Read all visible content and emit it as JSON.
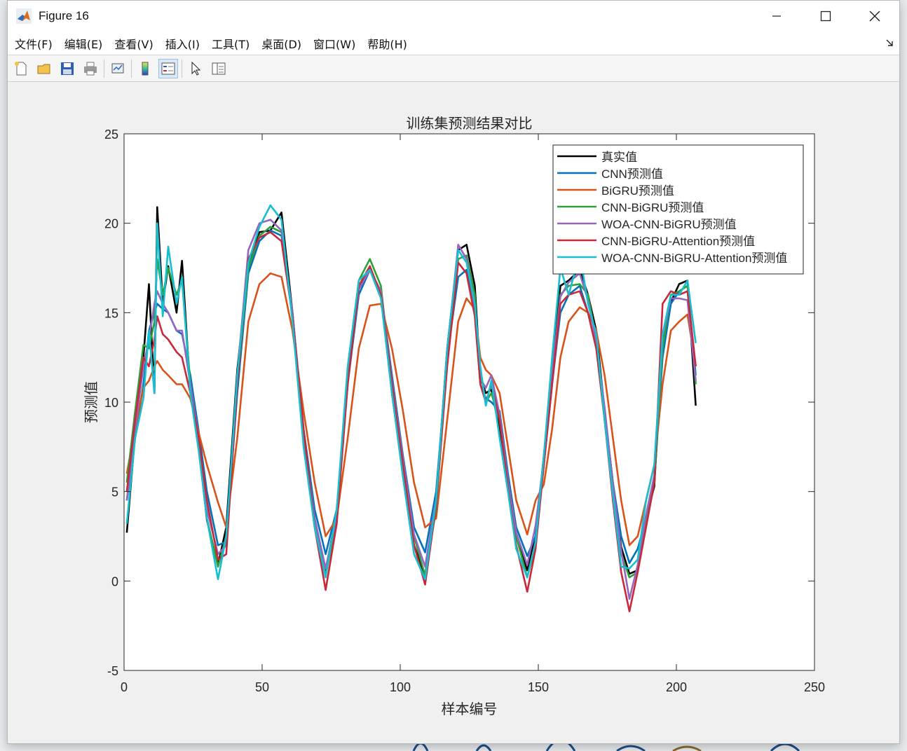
{
  "window": {
    "title": "Figure 16"
  },
  "menu": [
    "文件(F)",
    "编辑(E)",
    "查看(V)",
    "插入(I)",
    "工具(T)",
    "桌面(D)",
    "窗口(W)",
    "帮助(H)"
  ],
  "toolbar": {
    "icons": [
      "new-figure-icon",
      "open-file-icon",
      "save-icon",
      "print-icon",
      "link-plot-icon",
      "insert-colorbar-icon",
      "insert-legend-icon",
      "edit-plot-icon",
      "property-inspector-icon"
    ]
  },
  "colors": {
    "true": "#000000",
    "cnn": "#0072BD",
    "bigru": "#D95319",
    "cnn_bigru": "#2E9F3A",
    "woa_cnn_bigru": "#9467BD",
    "cnn_bigru_att": "#C8283A",
    "woa_cnn_bigru_att": "#17BECF"
  },
  "chart_data": {
    "type": "line",
    "title": "训练集预测结果对比",
    "xlabel": "样本编号",
    "ylabel": "预测值",
    "xlim": [
      0,
      250
    ],
    "ylim": [
      -5,
      25
    ],
    "xticks": [
      "0",
      "50",
      "100",
      "150",
      "200",
      "250"
    ],
    "yticks": [
      "-5",
      "0",
      "5",
      "10",
      "15",
      "20",
      "25"
    ],
    "grid": false,
    "legend_position": "top-right",
    "series": [
      {
        "name": "真实值",
        "color": "#000000",
        "x": [
          1,
          4,
          7,
          9,
          11,
          12,
          14,
          16,
          19,
          21,
          24,
          27,
          30,
          34,
          37,
          41,
          45,
          49,
          53,
          57,
          61,
          65,
          69,
          73,
          77,
          81,
          85,
          89,
          93,
          97,
          101,
          105,
          109,
          113,
          117,
          121,
          124,
          127,
          129,
          131,
          133,
          136,
          139,
          142,
          146,
          149,
          152,
          155,
          158,
          161,
          165,
          168,
          171,
          174,
          177,
          180,
          183,
          186,
          189,
          192,
          195,
          198,
          201,
          204,
          207
        ],
        "y": [
          2.7,
          8.2,
          12.5,
          16.6,
          10.5,
          20.9,
          15.5,
          17.6,
          15.0,
          17.9,
          10.5,
          7.6,
          3.4,
          0.9,
          3.0,
          11.8,
          17.5,
          19.5,
          19.6,
          20.6,
          15.0,
          8.0,
          3.5,
          0.6,
          3.8,
          11.6,
          16.5,
          17.5,
          16.0,
          10.5,
          6.0,
          2.0,
          0.3,
          4.5,
          13.0,
          18.5,
          18.8,
          16.5,
          11.4,
          10.5,
          10.7,
          8.5,
          5.5,
          2.5,
          0.6,
          2.5,
          7.0,
          11.8,
          16.5,
          16.8,
          17.4,
          16.0,
          14.0,
          9.5,
          5.5,
          1.9,
          0.4,
          0.6,
          3.5,
          5.3,
          13.5,
          15.6,
          16.6,
          16.8,
          9.8
        ]
      },
      {
        "name": "CNN预测值",
        "color": "#0072BD",
        "x": [
          1,
          4,
          7,
          9,
          11,
          12,
          14,
          16,
          19,
          21,
          24,
          27,
          30,
          34,
          37,
          41,
          45,
          49,
          53,
          57,
          61,
          65,
          69,
          73,
          77,
          81,
          85,
          89,
          93,
          97,
          101,
          105,
          109,
          113,
          117,
          121,
          124,
          127,
          129,
          131,
          133,
          136,
          139,
          142,
          146,
          149,
          152,
          155,
          158,
          161,
          165,
          168,
          171,
          174,
          177,
          180,
          183,
          186,
          189,
          192,
          195,
          198,
          201,
          204,
          207
        ],
        "y": [
          4.5,
          8.0,
          11.0,
          14.0,
          15.0,
          15.5,
          15.2,
          15.0,
          14.0,
          13.8,
          11.5,
          8.4,
          5.0,
          2.0,
          2.2,
          10.5,
          17.2,
          19.0,
          19.6,
          19.3,
          15.0,
          8.5,
          4.0,
          1.5,
          4.0,
          11.0,
          16.0,
          17.4,
          16.2,
          11.5,
          7.0,
          3.0,
          1.6,
          5.0,
          12.5,
          17.0,
          17.4,
          15.0,
          11.0,
          10.2,
          10.0,
          9.5,
          6.0,
          3.0,
          1.4,
          2.5,
          6.5,
          11.0,
          15.0,
          16.0,
          16.5,
          15.0,
          13.0,
          9.5,
          5.5,
          2.5,
          1.0,
          1.8,
          3.5,
          5.5,
          12.5,
          15.5,
          16.2,
          16.5,
          11.5
        ]
      },
      {
        "name": "BiGRU预测值",
        "color": "#D95319",
        "x": [
          1,
          4,
          7,
          9,
          11,
          12,
          14,
          16,
          19,
          21,
          24,
          27,
          30,
          34,
          37,
          41,
          45,
          49,
          53,
          57,
          61,
          65,
          69,
          73,
          77,
          81,
          85,
          89,
          93,
          97,
          101,
          105,
          109,
          113,
          117,
          121,
          124,
          127,
          129,
          131,
          133,
          136,
          139,
          142,
          146,
          149,
          152,
          155,
          158,
          161,
          165,
          168,
          171,
          174,
          177,
          180,
          183,
          186,
          189,
          192,
          195,
          198,
          201,
          204,
          207
        ],
        "y": [
          6.0,
          8.5,
          10.8,
          11.2,
          12.0,
          12.3,
          11.8,
          11.5,
          11.0,
          11.0,
          10.2,
          8.3,
          6.5,
          4.4,
          3.0,
          8.0,
          14.5,
          16.6,
          17.2,
          17.0,
          14.0,
          9.5,
          5.5,
          2.5,
          3.5,
          8.0,
          13.0,
          15.4,
          15.5,
          13.0,
          9.5,
          5.5,
          3.0,
          3.5,
          9.0,
          14.5,
          15.8,
          15.2,
          12.5,
          11.8,
          11.5,
          10.5,
          7.5,
          4.5,
          2.6,
          4.5,
          5.4,
          8.5,
          12.5,
          14.5,
          15.3,
          15.0,
          14.0,
          11.5,
          8.0,
          4.5,
          2.0,
          2.5,
          4.5,
          6.5,
          11.0,
          14.0,
          14.5,
          14.9,
          12.0
        ]
      },
      {
        "name": "CNN-BiGRU预测值",
        "color": "#2E9F3A",
        "x": [
          1,
          4,
          7,
          9,
          11,
          12,
          14,
          16,
          19,
          21,
          24,
          27,
          30,
          34,
          37,
          41,
          45,
          49,
          53,
          57,
          61,
          65,
          69,
          73,
          77,
          81,
          85,
          89,
          93,
          97,
          101,
          105,
          109,
          113,
          117,
          121,
          124,
          127,
          129,
          131,
          133,
          136,
          139,
          142,
          146,
          149,
          152,
          155,
          158,
          161,
          165,
          168,
          171,
          174,
          177,
          180,
          183,
          186,
          189,
          192,
          195,
          198,
          201,
          204,
          207
        ],
        "y": [
          5.5,
          9.5,
          13.2,
          13.0,
          14.5,
          18.0,
          16.0,
          17.5,
          16.0,
          16.8,
          11.0,
          7.5,
          3.5,
          0.8,
          2.5,
          11.0,
          17.5,
          19.3,
          19.8,
          19.5,
          14.8,
          8.0,
          3.5,
          0.3,
          3.5,
          11.5,
          16.8,
          18.0,
          16.5,
          11.0,
          6.5,
          2.5,
          0.3,
          4.0,
          12.5,
          18.0,
          18.2,
          16.0,
          11.0,
          10.0,
          10.5,
          9.0,
          5.5,
          2.5,
          0.2,
          2.0,
          6.5,
          11.5,
          16.0,
          16.5,
          16.6,
          16.0,
          13.5,
          9.0,
          5.0,
          1.5,
          0.2,
          0.5,
          3.5,
          5.5,
          13.0,
          16.0,
          16.2,
          16.5,
          11.0
        ]
      },
      {
        "name": "WOA-CNN-BiGRU预测值",
        "color": "#9467BD",
        "x": [
          1,
          4,
          7,
          9,
          11,
          12,
          14,
          16,
          19,
          21,
          24,
          27,
          30,
          34,
          37,
          41,
          45,
          49,
          53,
          57,
          61,
          65,
          69,
          73,
          77,
          81,
          85,
          89,
          93,
          97,
          101,
          105,
          109,
          113,
          117,
          121,
          124,
          127,
          129,
          131,
          133,
          136,
          139,
          142,
          146,
          149,
          152,
          155,
          158,
          161,
          165,
          168,
          171,
          174,
          177,
          180,
          183,
          186,
          189,
          192,
          195,
          198,
          201,
          204,
          207
        ],
        "y": [
          4.5,
          8.5,
          12.0,
          13.5,
          15.5,
          16.2,
          15.5,
          15.0,
          14.0,
          14.0,
          11.0,
          8.0,
          4.0,
          1.5,
          2.0,
          11.5,
          18.5,
          20.0,
          20.2,
          19.6,
          15.0,
          8.2,
          3.5,
          0.7,
          3.6,
          11.3,
          16.3,
          17.4,
          16.2,
          11.2,
          6.8,
          2.6,
          0.8,
          4.6,
          12.8,
          18.8,
          18.0,
          15.3,
          11.3,
          10.8,
          11.5,
          9.3,
          5.6,
          2.7,
          0.9,
          3.1,
          6.8,
          11.6,
          15.9,
          16.7,
          17.2,
          15.7,
          13.4,
          9.7,
          5.4,
          1.7,
          -1.0,
          0.9,
          3.7,
          5.9,
          13.7,
          15.8,
          15.8,
          15.7,
          11.2
        ]
      },
      {
        "name": "CNN-BiGRU-Attention预测值",
        "color": "#C8283A",
        "x": [
          1,
          4,
          7,
          9,
          11,
          12,
          14,
          16,
          19,
          21,
          24,
          27,
          30,
          34,
          37,
          41,
          45,
          49,
          53,
          57,
          61,
          65,
          69,
          73,
          77,
          81,
          85,
          89,
          93,
          97,
          101,
          105,
          109,
          113,
          117,
          121,
          124,
          127,
          129,
          131,
          133,
          136,
          139,
          142,
          146,
          149,
          152,
          155,
          158,
          161,
          165,
          168,
          171,
          174,
          177,
          180,
          183,
          186,
          189,
          192,
          195,
          198,
          201,
          204,
          207
        ],
        "y": [
          5.0,
          9.0,
          12.5,
          12.0,
          13.5,
          14.8,
          13.8,
          13.5,
          12.8,
          12.5,
          10.5,
          8.0,
          4.5,
          1.2,
          1.5,
          11.0,
          18.0,
          19.2,
          19.5,
          19.0,
          14.8,
          8.5,
          3.0,
          -0.5,
          3.2,
          11.0,
          16.5,
          17.6,
          16.0,
          11.0,
          6.5,
          2.0,
          -0.2,
          4.2,
          12.0,
          17.8,
          17.2,
          14.8,
          11.0,
          10.0,
          11.0,
          9.0,
          5.2,
          2.0,
          -0.6,
          1.8,
          6.5,
          11.0,
          15.5,
          16.0,
          16.2,
          15.0,
          13.0,
          9.0,
          4.5,
          0.5,
          -1.7,
          0.5,
          3.0,
          5.5,
          15.5,
          16.2,
          16.0,
          16.2,
          12.0
        ]
      },
      {
        "name": "WOA-CNN-BiGRU-Attention预测值",
        "color": "#17BECF",
        "x": [
          1,
          4,
          7,
          9,
          11,
          12,
          14,
          16,
          19,
          21,
          24,
          27,
          30,
          34,
          37,
          41,
          45,
          49,
          53,
          57,
          61,
          65,
          69,
          73,
          77,
          81,
          85,
          89,
          93,
          97,
          101,
          105,
          109,
          113,
          117,
          121,
          124,
          127,
          129,
          131,
          133,
          136,
          139,
          142,
          146,
          149,
          152,
          155,
          158,
          161,
          165,
          168,
          171,
          174,
          177,
          180,
          183,
          186,
          189,
          192,
          195,
          198,
          201,
          204,
          207
        ],
        "y": [
          3.2,
          8.0,
          10.2,
          14.0,
          10.5,
          20.0,
          14.8,
          18.7,
          15.5,
          17.0,
          10.5,
          7.3,
          3.5,
          0.1,
          2.5,
          11.5,
          17.8,
          19.8,
          21.0,
          20.2,
          14.5,
          7.5,
          3.0,
          0.2,
          4.0,
          12.0,
          16.8,
          17.4,
          15.8,
          10.5,
          5.8,
          1.5,
          0.1,
          4.5,
          13.0,
          18.5,
          17.8,
          15.5,
          12.0,
          9.8,
          11.2,
          8.0,
          5.0,
          1.8,
          0.2,
          2.2,
          7.0,
          12.5,
          17.5,
          16.0,
          18.3,
          15.5,
          13.8,
          9.0,
          4.8,
          0.8,
          0.7,
          1.2,
          4.5,
          6.5,
          13.8,
          16.0,
          16.0,
          16.8,
          13.3
        ]
      }
    ]
  }
}
